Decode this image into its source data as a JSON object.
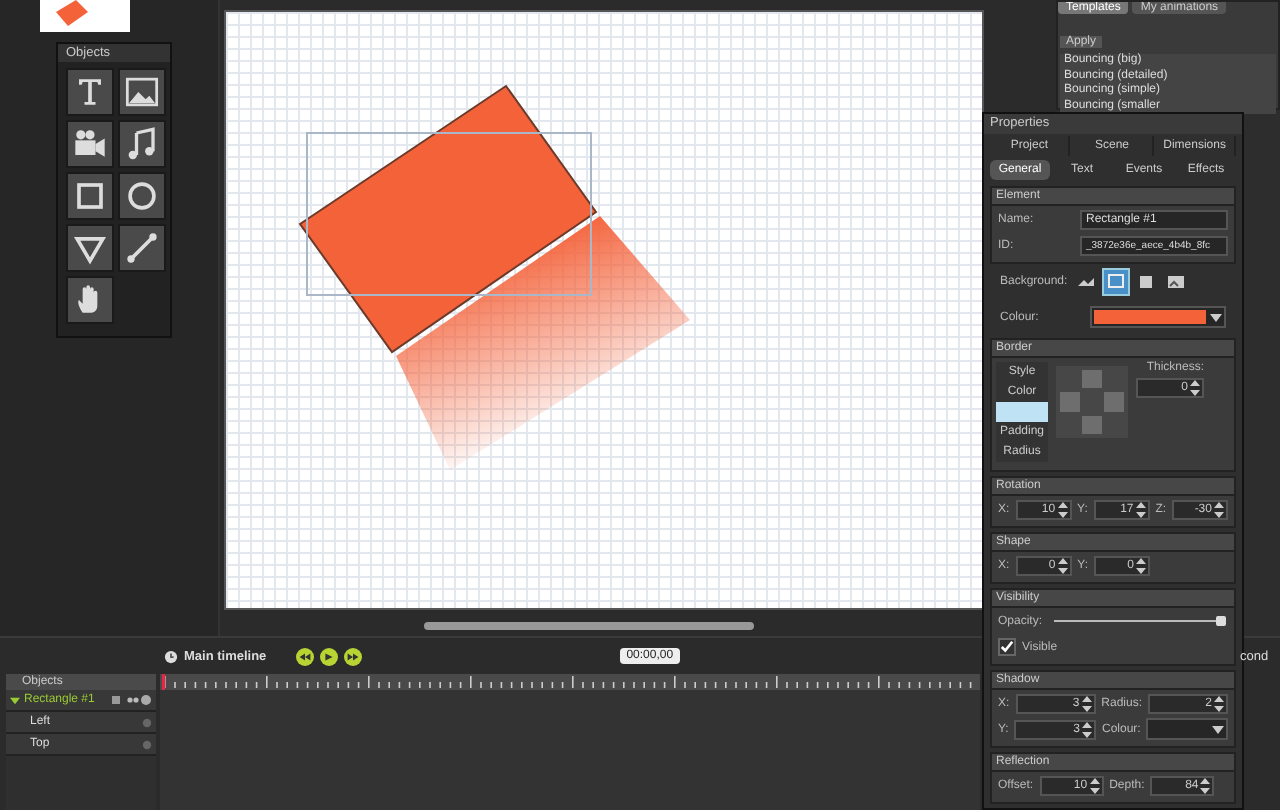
{
  "objects_palette": {
    "title": "Objects"
  },
  "templates_panel": {
    "tabs": [
      {
        "label": "Templates",
        "selected": true
      },
      {
        "label": "My animations",
        "selected": false
      }
    ],
    "apply_button": "Apply",
    "items": [
      "Bouncing (big)",
      "Bouncing (detailed)",
      "Bouncing (simple)",
      "Bouncing (smaller"
    ]
  },
  "properties": {
    "title": "Properties",
    "tabs_row_1": [
      {
        "label": "Project",
        "selected": false
      },
      {
        "label": "Scene",
        "selected": false
      },
      {
        "label": "Dimensions",
        "selected": false
      }
    ],
    "tabs_row_2": [
      {
        "label": "General",
        "selected": true
      },
      {
        "label": "Text",
        "selected": false
      },
      {
        "label": "Events",
        "selected": false
      },
      {
        "label": "Effects",
        "selected": false
      }
    ],
    "element": {
      "heading": "Element",
      "name_label": "Name:",
      "name_value": "Rectangle #1",
      "id_label": "ID:",
      "id_value": "_3872e36e_aece_4b4b_8fc"
    },
    "background": {
      "label": "Background:",
      "options": [
        {
          "selected": false
        },
        {
          "selected": true
        },
        {
          "selected": false
        },
        {
          "selected": false
        }
      ]
    },
    "colour": {
      "label": "Colour:",
      "color": "#f4623a"
    },
    "border": {
      "heading": "Border",
      "items": [
        {
          "kind": "text",
          "label": "Style",
          "selected": false
        },
        {
          "kind": "text",
          "label": "Color",
          "selected": false
        },
        {
          "kind": "blank",
          "selected": true
        },
        {
          "kind": "text",
          "label": "Padding",
          "selected": false
        },
        {
          "kind": "text",
          "label": "Radius",
          "selected": false
        }
      ],
      "thickness_label": "Thickness:",
      "thickness_value": "0"
    },
    "rotation": {
      "heading": "Rotation",
      "fields": [
        {
          "label": "X:",
          "value": "10"
        },
        {
          "label": "Y:",
          "value": "17"
        },
        {
          "label": "Z:",
          "value": "-30"
        }
      ]
    },
    "shape": {
      "heading": "Shape",
      "fields": [
        {
          "label": "X:",
          "value": "0"
        },
        {
          "label": "Y:",
          "value": "0"
        }
      ]
    },
    "visibility": {
      "heading": "Visibility",
      "opacity_label": "Opacity:",
      "level": 1,
      "visible_label": "Visible",
      "checked": true
    },
    "shadow": {
      "heading": "Shadow",
      "x_label": "X:",
      "x_value": "3",
      "radius_label": "Radius:",
      "radius_value": "2",
      "y_label": "Y:",
      "y_value": "3",
      "colour_label": "Colour:"
    },
    "reflection": {
      "heading": "Reflection",
      "offset_label": "Offset:",
      "offset_value": "10",
      "depth_label": "Depth:",
      "depth_value": "84"
    }
  },
  "timeline": {
    "title": "Main timeline",
    "time": "00:00,00",
    "objects_header": "Objects",
    "clipped_label": "cond",
    "tracks": [
      {
        "label": "Rectangle #1",
        "expanded": true,
        "children": [
          {
            "label": "Left"
          },
          {
            "label": "Top"
          }
        ]
      }
    ]
  }
}
